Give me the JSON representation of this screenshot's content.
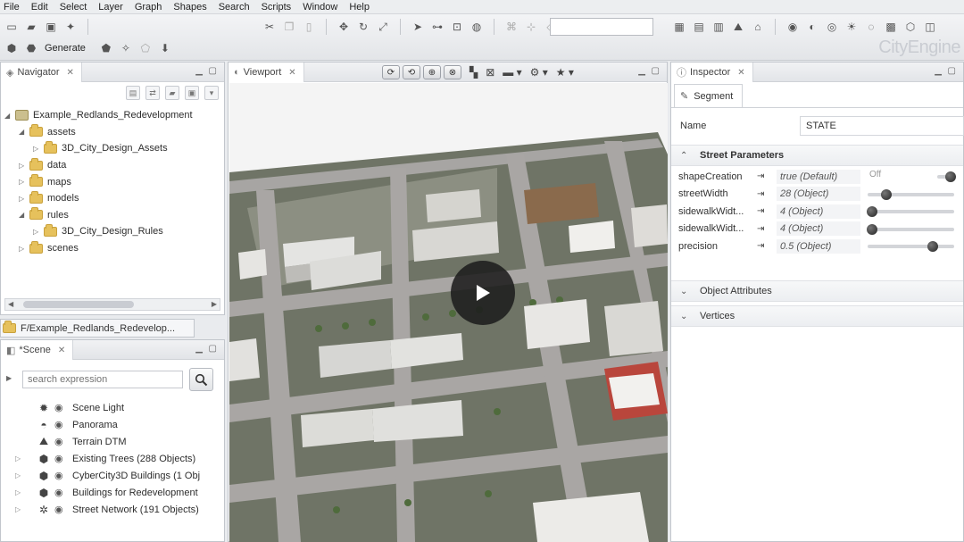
{
  "menu": [
    "File",
    "Edit",
    "Select",
    "Layer",
    "Graph",
    "Shapes",
    "Search",
    "Scripts",
    "Window",
    "Help"
  ],
  "toolbar": {
    "generate_label": "Generate",
    "logo": "CityEngine"
  },
  "navigator": {
    "tab": "Navigator",
    "tree": [
      {
        "label": "Example_Redlands_Redevelopment",
        "level": 0,
        "twisty": "open",
        "icon": "project-icon"
      },
      {
        "label": "assets",
        "level": 1,
        "twisty": "open",
        "icon": "folder-icon"
      },
      {
        "label": "3D_City_Design_Assets",
        "level": 2,
        "twisty": "closed",
        "icon": "folder-icon"
      },
      {
        "label": "data",
        "level": 1,
        "twisty": "closed",
        "icon": "folder-icon"
      },
      {
        "label": "maps",
        "level": 1,
        "twisty": "closed",
        "icon": "folder-icon"
      },
      {
        "label": "models",
        "level": 1,
        "twisty": "closed",
        "icon": "folder-icon"
      },
      {
        "label": "rules",
        "level": 1,
        "twisty": "open",
        "icon": "folder-icon"
      },
      {
        "label": "3D_City_Design_Rules",
        "level": 2,
        "twisty": "closed",
        "icon": "folder-icon"
      },
      {
        "label": "scenes",
        "level": 1,
        "twisty": "closed",
        "icon": "folder-icon"
      }
    ]
  },
  "path_bar": {
    "text": "F/Example_Redlands_Redevelop..."
  },
  "scene": {
    "tab": "*Scene",
    "search_placeholder": "search expression",
    "layers": [
      {
        "label": "Scene Light",
        "icon": "sun-icon",
        "expandable": false
      },
      {
        "label": "Panorama",
        "icon": "panorama-icon",
        "expandable": false
      },
      {
        "label": "Terrain DTM",
        "icon": "terrain-icon",
        "expandable": false
      },
      {
        "label": "Existing Trees (288 Objects)",
        "icon": "object-layer-icon",
        "expandable": true
      },
      {
        "label": "CyberCity3D Buildings (1 Obj",
        "icon": "object-layer-icon",
        "expandable": true
      },
      {
        "label": "Buildings for Redevelopment",
        "icon": "object-layer-icon",
        "expandable": true
      },
      {
        "label": "Street Network (191 Objects)",
        "icon": "network-icon",
        "expandable": true
      }
    ]
  },
  "viewport": {
    "tab": "Viewport",
    "media": "play-button"
  },
  "inspector": {
    "tab": "Inspector",
    "subtab": "Segment",
    "name_label": "Name",
    "name_value": "STATE",
    "sections": {
      "street_parameters": "Street Parameters",
      "object_attributes": "Object Attributes",
      "vertices": "Vertices"
    },
    "attributes": [
      {
        "name": "shapeCreation",
        "value": "true (Default)",
        "control": "toggle",
        "off_label": "Off",
        "level": 1.0
      },
      {
        "name": "streetWidth",
        "value": "28 (Object)",
        "control": "slider",
        "level": 0.22
      },
      {
        "name": "sidewalkWidt...",
        "value": "4 (Object)",
        "control": "slider",
        "level": 0.05
      },
      {
        "name": "sidewalkWidt...",
        "value": "4 (Object)",
        "control": "slider",
        "level": 0.05
      },
      {
        "name": "precision",
        "value": "0.5 (Object)",
        "control": "slider",
        "level": 0.75
      }
    ]
  }
}
